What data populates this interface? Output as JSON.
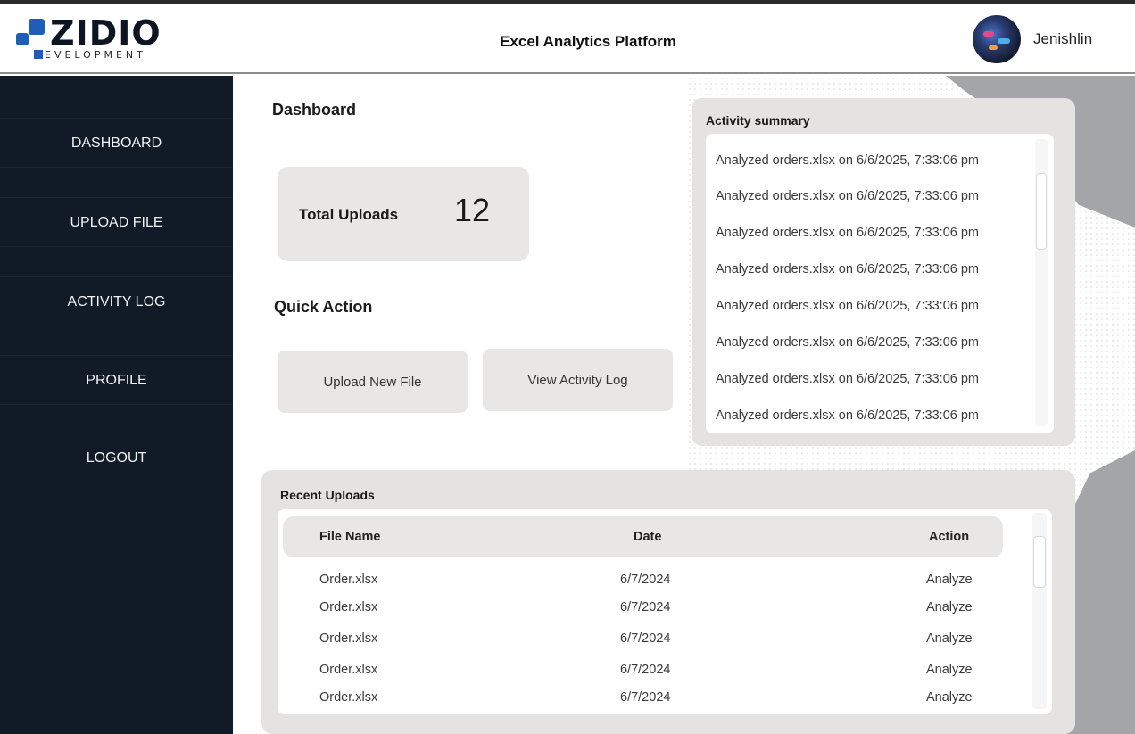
{
  "header": {
    "logo_text": "ZIDIO",
    "logo_sub": "EVELOPMENT",
    "app_title": "Excel Analytics Platform",
    "username": "Jenishlin"
  },
  "sidebar": {
    "items": [
      {
        "label": "DASHBOARD"
      },
      {
        "label": "UPLOAD FILE"
      },
      {
        "label": "ACTIVITY LOG"
      },
      {
        "label": "PROFILE"
      },
      {
        "label": "LOGOUT"
      }
    ]
  },
  "dashboard": {
    "title": "Dashboard",
    "total_uploads_label": "Total Uploads",
    "total_uploads_value": "12",
    "quick_action_title": "Quick Action",
    "upload_new_file_label": "Upload New File",
    "view_activity_log_label": "View Activity Log"
  },
  "activity": {
    "title": "Activity summary",
    "items": [
      "Analyzed orders.xlsx on 6/6/2025, 7:33:06 pm",
      "Analyzed orders.xlsx on 6/6/2025, 7:33:06 pm",
      "Analyzed orders.xlsx on 6/6/2025, 7:33:06 pm",
      "Analyzed orders.xlsx on 6/6/2025, 7:33:06 pm",
      "Analyzed orders.xlsx on 6/6/2025, 7:33:06 pm",
      "Analyzed orders.xlsx on 6/6/2025, 7:33:06 pm",
      "Analyzed orders.xlsx on 6/6/2025, 7:33:06 pm",
      "Analyzed orders.xlsx on 6/6/2025, 7:33:06 pm"
    ]
  },
  "uploads": {
    "title": "Recent Uploads",
    "columns": [
      "File Name",
      "Date",
      "Action"
    ],
    "rows": [
      {
        "file": "Order.xlsx",
        "date": "6/7/2024",
        "action": "Analyze"
      },
      {
        "file": "Order.xlsx",
        "date": "6/7/2024",
        "action": "Analyze"
      },
      {
        "file": "Order.xlsx",
        "date": "6/7/2024",
        "action": "Analyze"
      },
      {
        "file": "Order.xlsx",
        "date": "6/7/2024",
        "action": "Analyze"
      },
      {
        "file": "Order.xlsx",
        "date": "6/7/2024",
        "action": "Analyze"
      }
    ]
  }
}
